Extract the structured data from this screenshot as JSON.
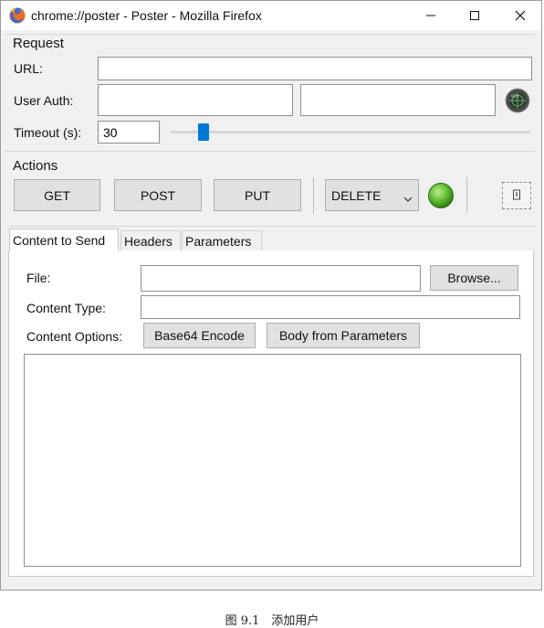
{
  "window": {
    "title": "chrome://poster - Poster - Mozilla Firefox"
  },
  "request": {
    "legend": "Request",
    "url_label": "URL:",
    "url_value": "",
    "user_auth_label": "User Auth:",
    "user_value": "",
    "password_value": "",
    "timeout_label": "Timeout (s):",
    "timeout_value": "30"
  },
  "actions": {
    "legend": "Actions",
    "get": "GET",
    "post": "POST",
    "put": "PUT",
    "method_selected": "DELETE",
    "status_color": "#5cb82e"
  },
  "tabs": [
    {
      "label": "Content to Send",
      "active": true
    },
    {
      "label": "Headers",
      "active": false
    },
    {
      "label": "Parameters",
      "active": false
    }
  ],
  "content": {
    "file_label": "File:",
    "file_value": "",
    "browse": "Browse...",
    "content_type_label": "Content Type:",
    "content_type_value": "",
    "content_options_label": "Content Options:",
    "base64": "Base64 Encode",
    "body_from_params": "Body from Parameters",
    "body_value": ""
  },
  "caption": "图 9.1　添加用户"
}
